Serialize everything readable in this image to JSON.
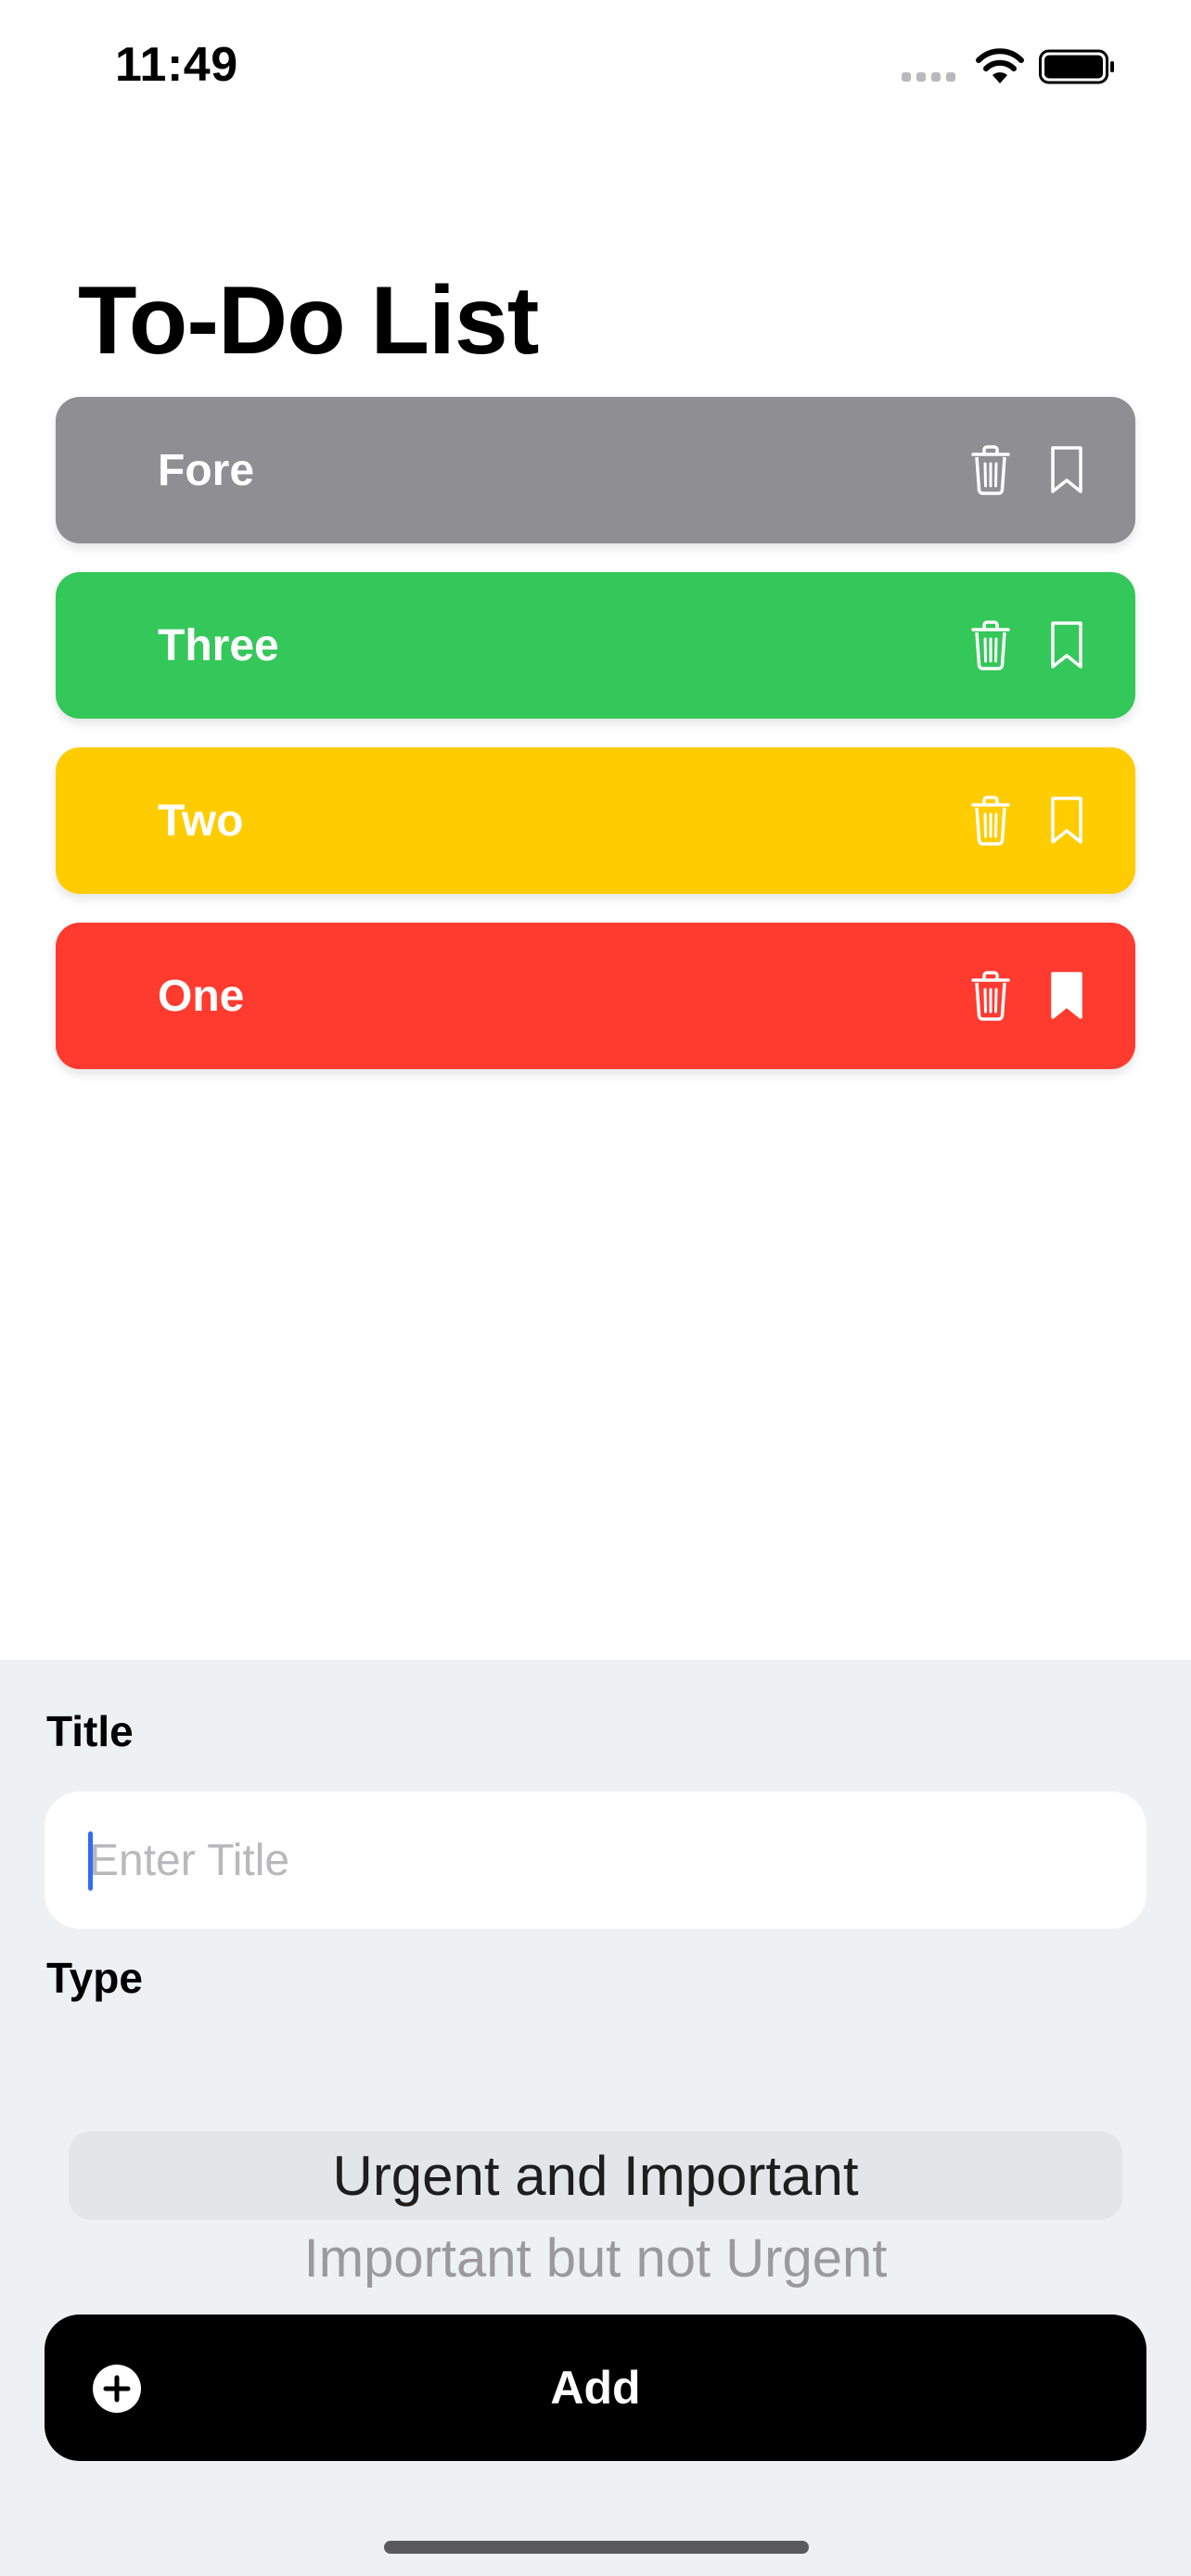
{
  "status_bar": {
    "time": "11:49"
  },
  "page": {
    "title": "To-Do List"
  },
  "tasks": [
    {
      "title": "Fore",
      "color": "#8e8e93",
      "bookmarked": false
    },
    {
      "title": "Three",
      "color": "#34c759",
      "bookmarked": false
    },
    {
      "title": "Two",
      "color": "#ffcc00",
      "bookmarked": false
    },
    {
      "title": "One",
      "color": "#ff3b30",
      "bookmarked": true
    }
  ],
  "form": {
    "title_label": "Title",
    "title_placeholder": "Enter Title",
    "title_value": "",
    "type_label": "Type",
    "type_options": [
      "Urgent and Important",
      "Important but not Urgent"
    ],
    "type_selected": "Urgent and Important",
    "add_label": "Add"
  },
  "colors": {
    "accent": "#2f6bf5",
    "panel_bg": "#eef1f3"
  },
  "icons": [
    "trash-icon",
    "bookmark-icon",
    "plus-circle-icon",
    "wifi-icon",
    "battery-icon"
  ]
}
